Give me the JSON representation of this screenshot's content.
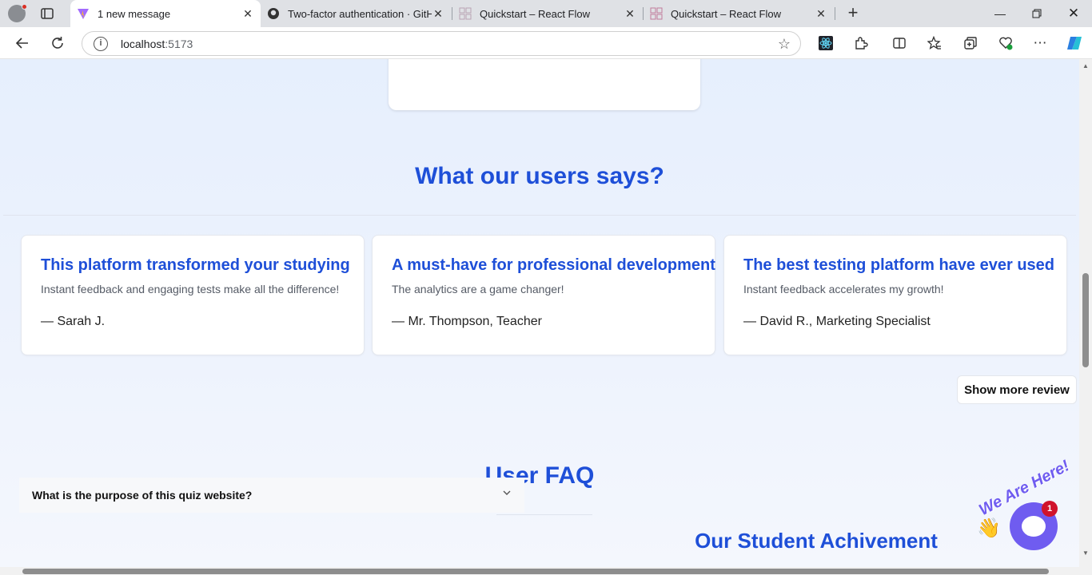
{
  "browser": {
    "tabs": [
      {
        "title": "1 new message",
        "favicon": "vite-logo-icon"
      },
      {
        "title": "Two-factor authentication · GitHub",
        "favicon": "github-icon"
      },
      {
        "title": "Quickstart – React Flow",
        "favicon": "react-flow-icon"
      },
      {
        "title": "Quickstart – React Flow",
        "favicon": "react-flow-icon"
      }
    ],
    "url_host": "localhost",
    "url_port": ":5173",
    "accent": "#1e4fd8"
  },
  "testimonials": {
    "heading": "What our users says?",
    "reviews": [
      {
        "title": "This platform transformed your studying",
        "text": "Instant feedback and engaging tests make all the difference!",
        "author": "— Sarah J."
      },
      {
        "title": "A must-have for professional development",
        "text": "The analytics are a game changer!",
        "author": "— Mr. Thompson, Teacher"
      },
      {
        "title": "The best testing platform have ever used",
        "text": "Instant feedback accelerates my growth!",
        "author": "— David R., Marketing Specialist"
      }
    ],
    "show_more_label": "Show more review"
  },
  "faq": {
    "heading": "User FAQ",
    "items": [
      {
        "question": "What is the purpose of this quiz website?"
      }
    ]
  },
  "achievement": {
    "heading": "Our Student Achivement"
  },
  "chat_widget": {
    "tagline": "We Are Here!",
    "badge_count": "1"
  }
}
